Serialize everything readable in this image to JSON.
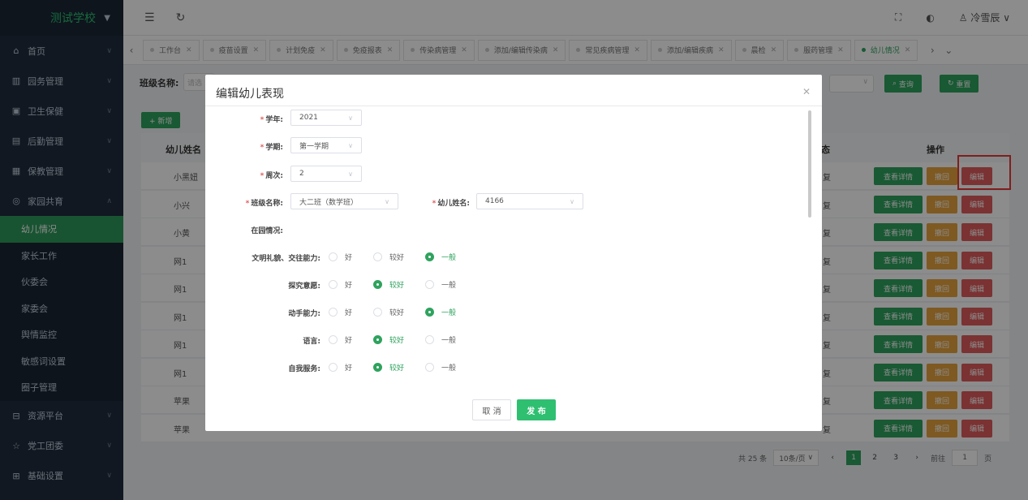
{
  "sidebar": {
    "brand": "测试学校",
    "items": [
      {
        "icon": "⌂",
        "label": "首页"
      },
      {
        "icon": "▥",
        "label": "园务管理"
      },
      {
        "icon": "▣",
        "label": "卫生保健"
      },
      {
        "icon": "▤",
        "label": "后勤管理"
      },
      {
        "icon": "▦",
        "label": "保教管理"
      },
      {
        "icon": "◎",
        "label": "家园共育"
      }
    ],
    "subitems": [
      "幼儿情况",
      "家长工作",
      "伙委会",
      "家委会",
      "舆情监控",
      "敏感词设置",
      "圈子管理"
    ],
    "items2": [
      {
        "icon": "⊟",
        "label": "资源平台"
      },
      {
        "icon": "☆",
        "label": "党工团委"
      },
      {
        "icon": "⊞",
        "label": "基础设置"
      }
    ]
  },
  "topbar": {
    "user": "冷雪辰 ∨"
  },
  "tabs": [
    "工作台",
    "疫苗设置",
    "计划免疫",
    "免疫报表",
    "传染病管理",
    "添加/编辑传染病",
    "常见疾病管理",
    "添加/编辑疾病",
    "晨检",
    "服药管理",
    "幼儿情况"
  ],
  "main": {
    "search_label": "班级名称:",
    "search_placeholder": "请选",
    "query_btn": "查询",
    "reset_btn": "重置",
    "add_btn": "+ 新增",
    "col_name": "幼儿姓名",
    "col_status": "态",
    "col_ops": "操作",
    "rows": [
      {
        "name": "小黑妞",
        "status": "复"
      },
      {
        "name": "小兴",
        "status": "复"
      },
      {
        "name": "小黄",
        "status": "复"
      },
      {
        "name": "网1",
        "status": "复"
      },
      {
        "name": "网1",
        "status": "复"
      },
      {
        "name": "网1",
        "status": "复"
      },
      {
        "name": "网1",
        "status": "复"
      },
      {
        "name": "网1",
        "status": "复"
      },
      {
        "name": "苹果",
        "status": "复"
      },
      {
        "name": "苹果",
        "status": "复"
      }
    ],
    "op_detail": "查看详情",
    "op_withdraw": "撤回",
    "op_edit": "编辑",
    "pager": {
      "total": "共 25 条",
      "size": "10条/页",
      "pages": [
        "1",
        "2",
        "3"
      ],
      "goto": "前往",
      "page_input": "1",
      "page_unit": "页"
    }
  },
  "dialog": {
    "title": "编辑幼儿表现",
    "year_label": "学年:",
    "year_value": "2021",
    "term_label": "学期:",
    "term_value": "第一学期",
    "week_label": "周次:",
    "week_value": "2",
    "class_label": "班级名称:",
    "class_value": "大二班（数学班）",
    "child_label": "幼儿姓名:",
    "child_value": "4166",
    "section_label": "在园情况:",
    "options": [
      "好",
      "较好",
      "一般"
    ],
    "criteria": [
      {
        "label": "文明礼貌、交往能力:",
        "selected": 2
      },
      {
        "label": "探究意愿:",
        "selected": 1
      },
      {
        "label": "动手能力:",
        "selected": 2
      },
      {
        "label": "语言:",
        "selected": 1
      },
      {
        "label": "自我服务:",
        "selected": 1
      }
    ],
    "cancel": "取 消",
    "submit": "发 布"
  }
}
